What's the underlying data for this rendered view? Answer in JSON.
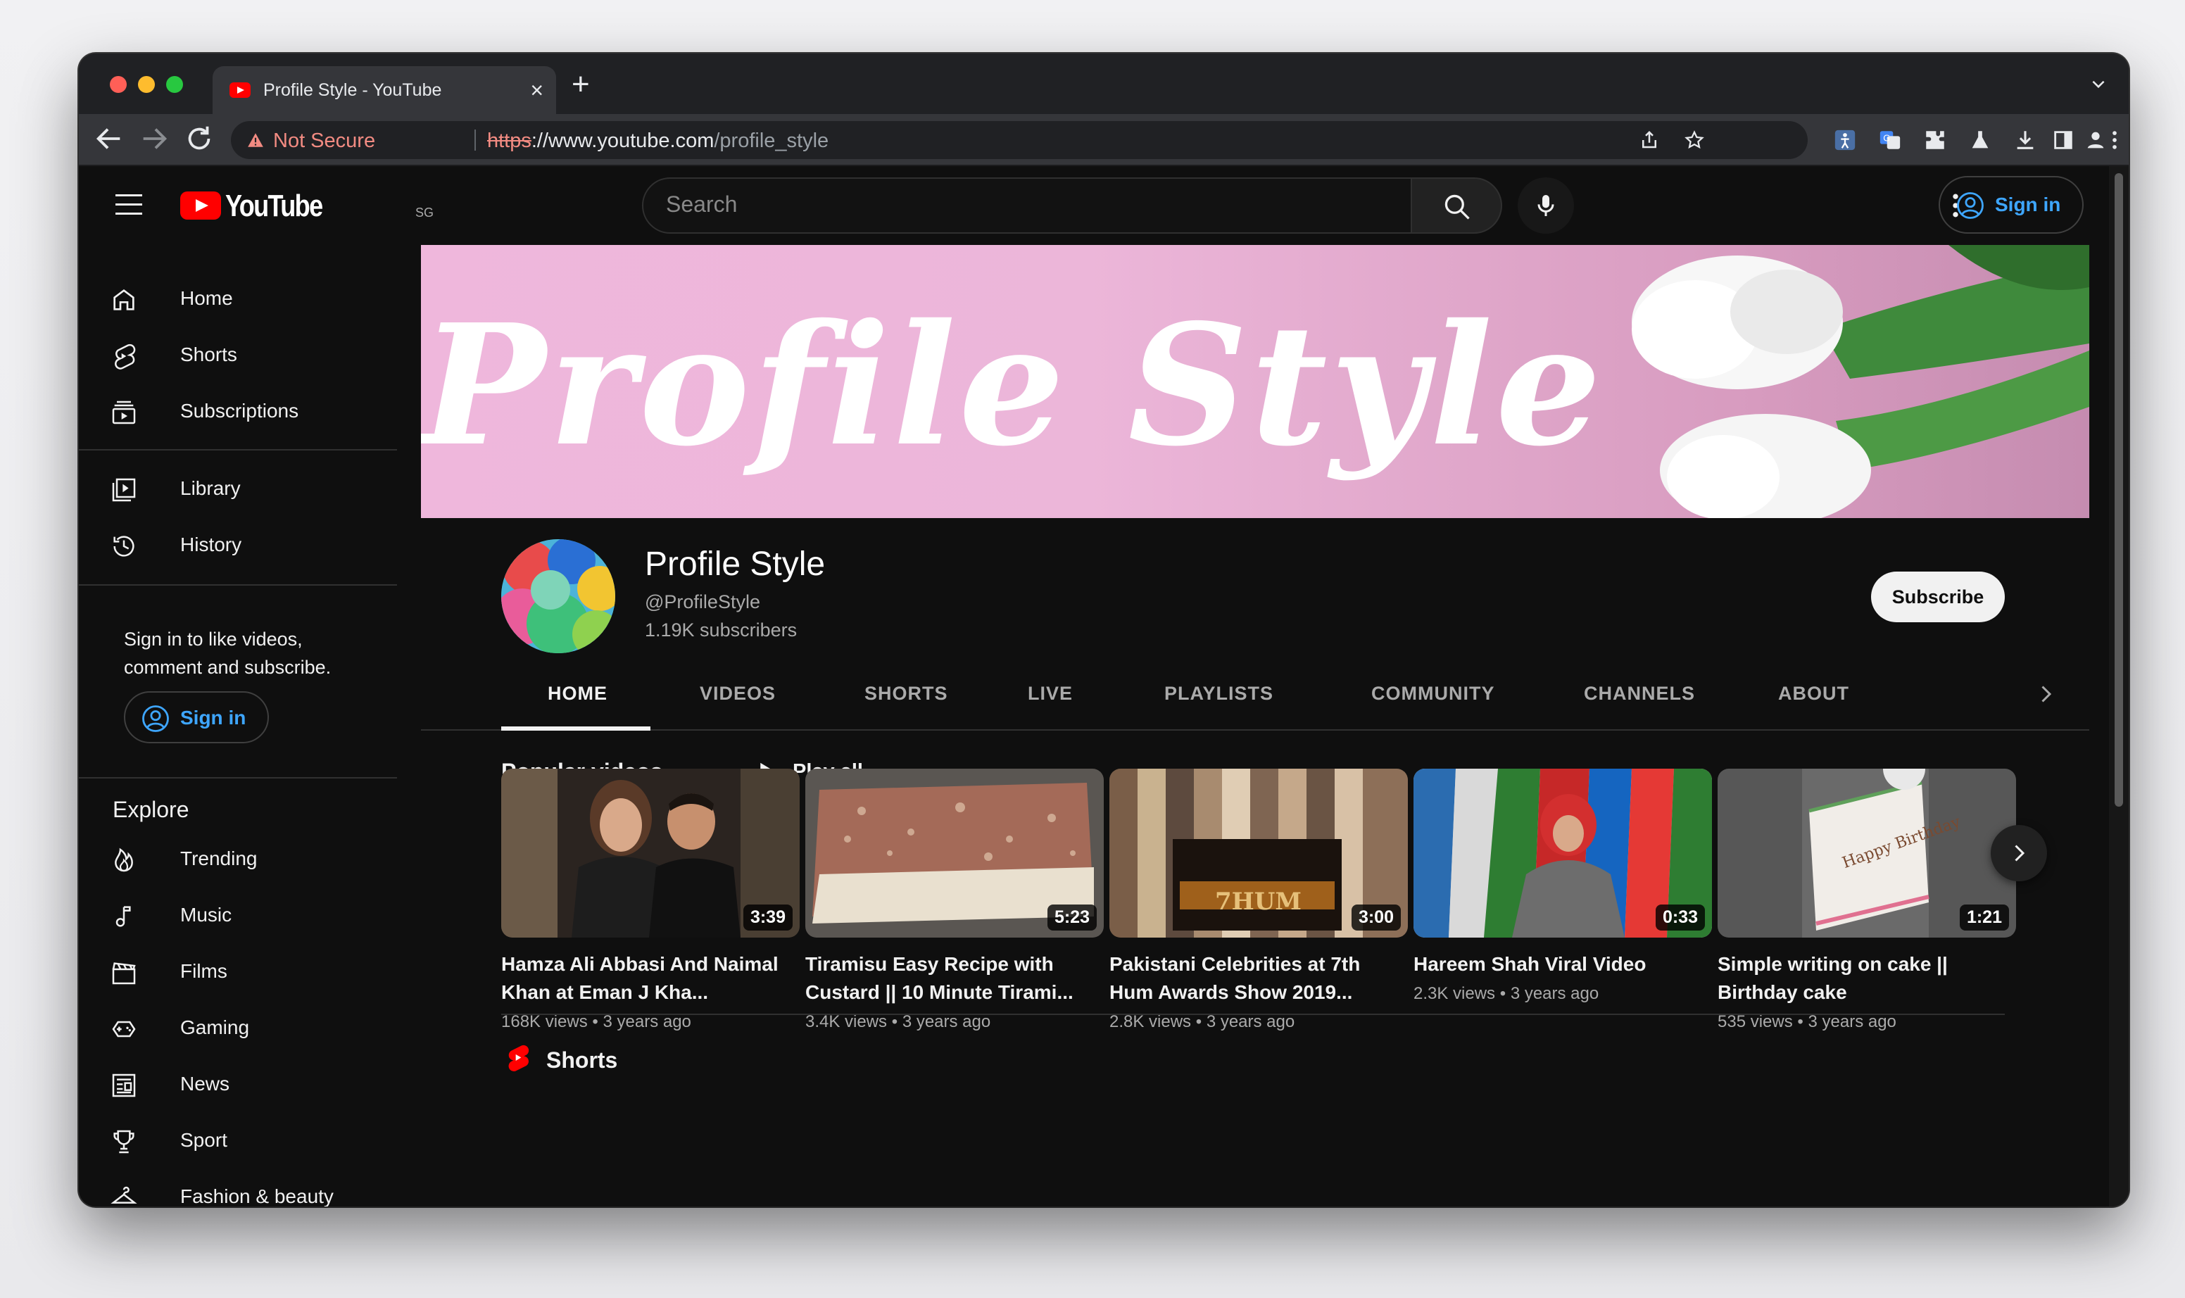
{
  "browser": {
    "tab_title": "Profile Style - YouTube",
    "not_secure": "Not Secure",
    "url_proto": "https",
    "url_host": "://www.youtube.com",
    "url_path": "/profile_style"
  },
  "masthead": {
    "logo_text": "YouTube",
    "country_code": "SG",
    "search_placeholder": "Search",
    "sign_in": "Sign in"
  },
  "sidebar": {
    "primary": [
      {
        "label": "Home",
        "icon": "home-icon"
      },
      {
        "label": "Shorts",
        "icon": "shorts-icon"
      },
      {
        "label": "Subscriptions",
        "icon": "subscriptions-icon"
      }
    ],
    "you": [
      {
        "label": "Library",
        "icon": "library-icon"
      },
      {
        "label": "History",
        "icon": "history-icon"
      }
    ],
    "signin_message": "Sign in to like videos, comment and subscribe.",
    "sign_in": "Sign in",
    "explore_heading": "Explore",
    "explore": [
      {
        "label": "Trending",
        "icon": "trending-icon"
      },
      {
        "label": "Music",
        "icon": "music-icon"
      },
      {
        "label": "Films",
        "icon": "films-icon"
      },
      {
        "label": "Gaming",
        "icon": "gaming-icon"
      },
      {
        "label": "News",
        "icon": "news-icon"
      },
      {
        "label": "Sport",
        "icon": "sport-icon"
      },
      {
        "label": "Fashion & beauty",
        "icon": "fashion-icon"
      }
    ]
  },
  "channel": {
    "banner_text": "Profile Style",
    "name": "Profile Style",
    "handle": "@ProfileStyle",
    "subscribers": "1.19K subscribers",
    "subscribe": "Subscribe",
    "tabs": [
      "HOME",
      "VIDEOS",
      "SHORTS",
      "LIVE",
      "PLAYLISTS",
      "COMMUNITY",
      "CHANNELS",
      "ABOUT"
    ],
    "active_tab": "HOME"
  },
  "popular": {
    "title": "Popular videos",
    "play_all": "Play all",
    "videos": [
      {
        "title": "Hamza Ali Abbasi And Naimal Khan at Eman J Kha...",
        "duration": "3:39",
        "views": "168K views",
        "age": "3 years ago"
      },
      {
        "title": "Tiramisu Easy Recipe with Custard || 10 Minute Tirami...",
        "duration": "5:23",
        "views": "3.4K views",
        "age": "3 years ago"
      },
      {
        "title": "Pakistani Celebrities at 7th Hum Awards Show 2019...",
        "duration": "3:00",
        "views": "2.8K views",
        "age": "3 years ago"
      },
      {
        "title": "Hareem Shah Viral Video",
        "duration": "0:33",
        "views": "2.3K views",
        "age": "3 years ago"
      },
      {
        "title": "Simple writing on cake || Birthday cake",
        "duration": "1:21",
        "views": "535 views",
        "age": "3 years ago"
      }
    ]
  },
  "shorts_section": {
    "title": "Shorts"
  },
  "colors": {
    "yt_red": "#ff0000",
    "link_blue": "#3ea6ff",
    "bg": "#0f0f0f",
    "banner_pink": "#efb7dc"
  }
}
